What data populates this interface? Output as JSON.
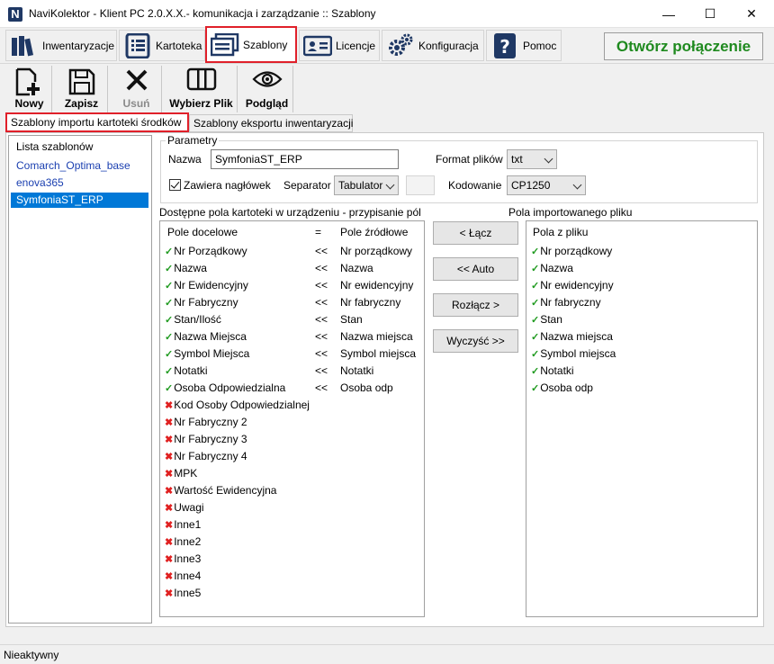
{
  "window": {
    "title": "NaviKolektor - Klient PC 2.0.X.X.- komunikacja i zarządzanie :: Szablony",
    "minimize": "—",
    "maximize": "☐",
    "close": "✕"
  },
  "main_tabs": [
    {
      "label": "Inwentaryzacje",
      "icon": "books-icon"
    },
    {
      "label": "Kartoteka",
      "icon": "list-icon"
    },
    {
      "label": "Szablony",
      "icon": "template-icon",
      "active": true
    },
    {
      "label": "Licencje",
      "icon": "id-card-icon"
    },
    {
      "label": "Konfiguracja",
      "icon": "gears-icon"
    },
    {
      "label": "Pomoc",
      "icon": "help-icon"
    }
  ],
  "connect_button": "Otwórz połączenie",
  "toolbar": {
    "new": "Nowy",
    "save": "Zapisz",
    "delete": "Usuń",
    "choose_file": "Wybierz Plik",
    "preview": "Podgląd"
  },
  "sub_tabs": {
    "import": "Szablony importu kartoteki środków",
    "export": "Szablony eksportu inwentaryzacji"
  },
  "templates": {
    "header": "Lista szablonów",
    "items": [
      "Comarch_Optima_base",
      "enova365",
      "SymfoniaST_ERP"
    ],
    "selected": "SymfoniaST_ERP"
  },
  "params": {
    "legend": "Parametry",
    "name_label": "Nazwa",
    "name_value": "SymfoniaST_ERP",
    "format_label": "Format plików",
    "format_value": "txt",
    "headers_label": "Zawiera nagłówek",
    "headers_checked": true,
    "separator_label": "Separator",
    "separator_value": "Tabulator",
    "encoding_label": "Kodowanie",
    "encoding_value": "CP1250"
  },
  "mapping": {
    "title": "Dostępne pola kartoteki w urządzeniu - przypisanie pól",
    "col_target": "Pole docelowe",
    "col_eq": "=",
    "col_source": "Pole źródłowe",
    "rows": [
      {
        "target": "Nr Porządkowy",
        "mapped": true,
        "op": "<<",
        "source": "Nr porządkowy"
      },
      {
        "target": "Nazwa",
        "mapped": true,
        "op": "<<",
        "source": "Nazwa"
      },
      {
        "target": "Nr Ewidencyjny",
        "mapped": true,
        "op": "<<",
        "source": "Nr ewidencyjny"
      },
      {
        "target": "Nr Fabryczny",
        "mapped": true,
        "op": "<<",
        "source": "Nr fabryczny"
      },
      {
        "target": "Stan/Ilość",
        "mapped": true,
        "op": "<<",
        "source": "Stan"
      },
      {
        "target": "Nazwa Miejsca",
        "mapped": true,
        "op": "<<",
        "source": "Nazwa miejsca"
      },
      {
        "target": "Symbol Miejsca",
        "mapped": true,
        "op": "<<",
        "source": "Symbol miejsca"
      },
      {
        "target": "Notatki",
        "mapped": true,
        "op": "<<",
        "source": "Notatki"
      },
      {
        "target": "Osoba Odpowiedzialna",
        "mapped": true,
        "op": "<<",
        "source": "Osoba odp"
      },
      {
        "target": "Kod Osoby Odpowiedzialnej",
        "mapped": false,
        "op": "",
        "source": ""
      },
      {
        "target": "Nr Fabryczny 2",
        "mapped": false,
        "op": "",
        "source": ""
      },
      {
        "target": "Nr Fabryczny 3",
        "mapped": false,
        "op": "",
        "source": ""
      },
      {
        "target": "Nr Fabryczny 4",
        "mapped": false,
        "op": "",
        "source": ""
      },
      {
        "target": "MPK",
        "mapped": false,
        "op": "",
        "source": ""
      },
      {
        "target": "Wartość Ewidencyjna",
        "mapped": false,
        "op": "",
        "source": ""
      },
      {
        "target": "Uwagi",
        "mapped": false,
        "op": "",
        "source": ""
      },
      {
        "target": "Inne1",
        "mapped": false,
        "op": "",
        "source": ""
      },
      {
        "target": "Inne2",
        "mapped": false,
        "op": "",
        "source": ""
      },
      {
        "target": "Inne3",
        "mapped": false,
        "op": "",
        "source": ""
      },
      {
        "target": "Inne4",
        "mapped": false,
        "op": "",
        "source": ""
      },
      {
        "target": "Inne5",
        "mapped": false,
        "op": "",
        "source": ""
      }
    ]
  },
  "action_buttons": {
    "link": "< Łącz",
    "auto": "<< Auto",
    "unlink": "Rozłącz >",
    "clear": "Wyczyść >>"
  },
  "file_fields": {
    "title": "Pola importowanego pliku",
    "col_header": "Pola z pliku",
    "items": [
      "Nr porządkowy",
      "Nazwa",
      "Nr ewidencyjny",
      "Nr fabryczny",
      "Stan",
      "Nazwa miejsca",
      "Symbol miejsca",
      "Notatki",
      "Osoba odp"
    ]
  },
  "status": "Nieaktywny",
  "colors": {
    "highlight": "#e0202a",
    "selection": "#0078d7",
    "ok": "#1f9a1f",
    "error": "#e02020",
    "connect": "#1f8a1f"
  }
}
